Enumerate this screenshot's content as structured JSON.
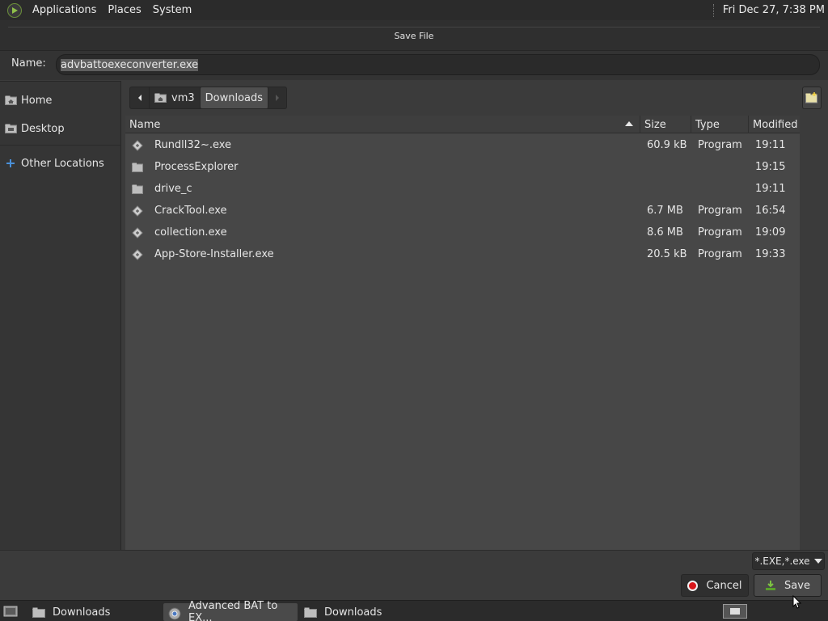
{
  "top_panel": {
    "menus": [
      "Applications",
      "Places",
      "System"
    ],
    "clock": "Fri Dec 27,  7:38 PM"
  },
  "window": {
    "title": "Save File"
  },
  "name_field": {
    "label": "Name:",
    "value": "advbattoexeconverter.exe"
  },
  "sidebar": {
    "items": [
      {
        "label": "Home",
        "icon": "home-folder-icon"
      },
      {
        "label": "Desktop",
        "icon": "desktop-folder-icon"
      },
      {
        "label": "Other Locations",
        "icon": "plus-icon"
      }
    ]
  },
  "path": {
    "segments": [
      "vm3",
      "Downloads"
    ]
  },
  "file_list": {
    "columns": [
      "Name",
      "Size",
      "Type",
      "Modified"
    ],
    "rows": [
      {
        "name": "Rundll32~.exe",
        "size": "60.9 kB",
        "type": "Program",
        "modified": "19:11",
        "icon": "executable-icon"
      },
      {
        "name": "ProcessExplorer",
        "size": "",
        "type": "",
        "modified": "19:15",
        "icon": "folder-icon"
      },
      {
        "name": "drive_c",
        "size": "",
        "type": "",
        "modified": "19:11",
        "icon": "folder-icon"
      },
      {
        "name": "CrackTool.exe",
        "size": "6.7 MB",
        "type": "Program",
        "modified": "16:54",
        "icon": "executable-icon"
      },
      {
        "name": "collection.exe",
        "size": "8.6 MB",
        "type": "Program",
        "modified": "19:09",
        "icon": "executable-icon"
      },
      {
        "name": "App-Store-Installer.exe",
        "size": "20.5 kB",
        "type": "Program",
        "modified": "19:33",
        "icon": "executable-icon"
      }
    ]
  },
  "filter": {
    "value": "*.EXE,*.exe"
  },
  "buttons": {
    "cancel": "Cancel",
    "save": "Save"
  },
  "taskbar": {
    "tasks": [
      {
        "label": "Downloads",
        "active": false
      },
      {
        "label": "Advanced BAT to EX...",
        "active": true
      },
      {
        "label": "Downloads",
        "active": false
      }
    ]
  },
  "colors": {
    "cancel_red": "#d8161a",
    "save_green": "#5aa02c"
  }
}
